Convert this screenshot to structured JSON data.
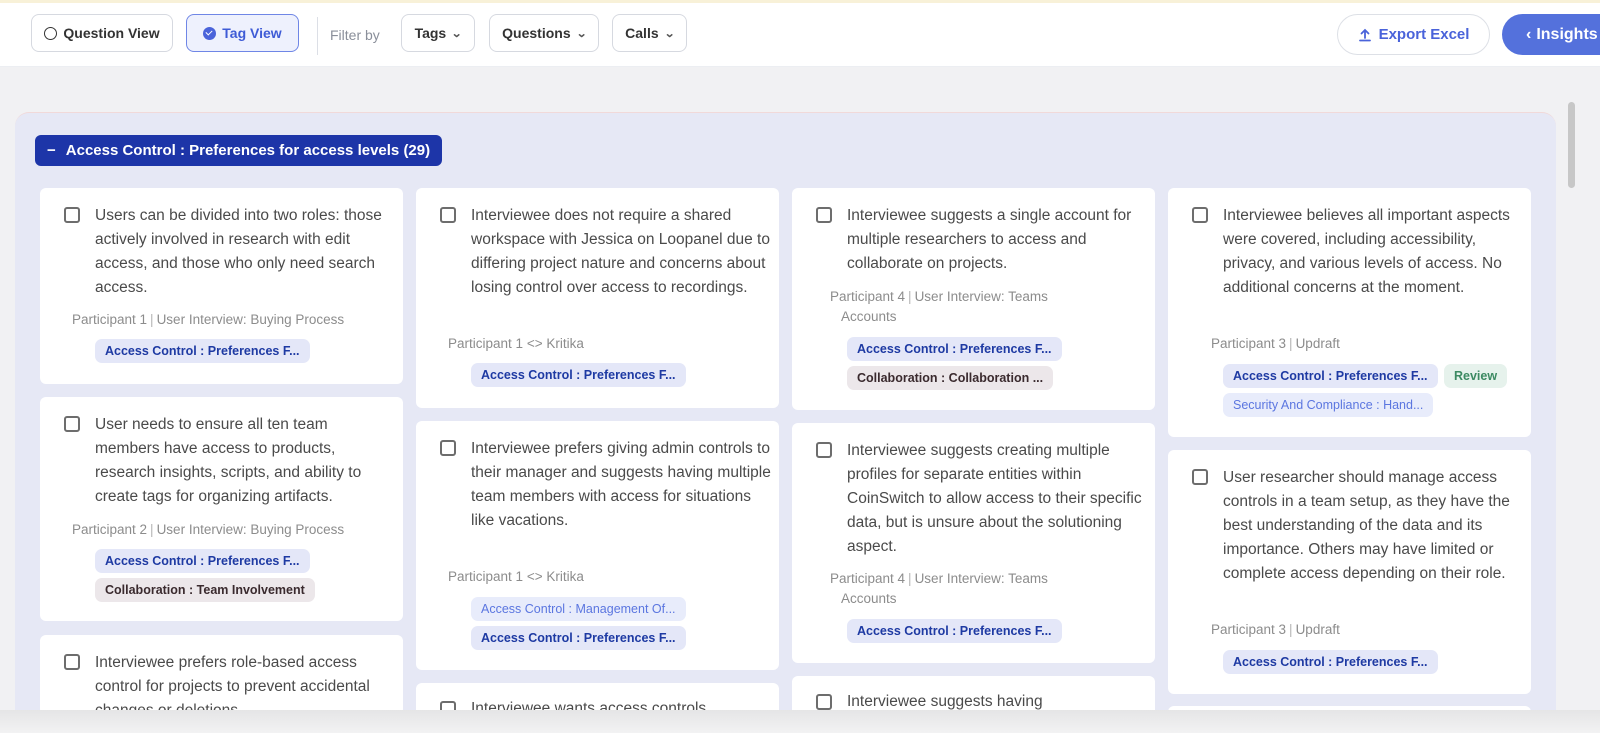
{
  "toolbar": {
    "question_view": "Question View",
    "tag_view": "Tag View",
    "filter_by": "Filter by",
    "tags": "Tags",
    "questions": "Questions",
    "calls": "Calls",
    "export_excel": "Export Excel",
    "insights": "Insights"
  },
  "group": {
    "title": "Access Control : Preferences for access levels (29)",
    "collapse_symbol": "−"
  },
  "cards": [
    {
      "text": "Users can be divided into two roles: those actively involved in research with edit access, and those who only need search access.",
      "participant": "Participant 1",
      "source": "User Interview: Buying Process",
      "tags": [
        "Access Control : Preferences F..."
      ]
    },
    {
      "text": "User needs to ensure all ten team members have access to products, research insights, scripts, and ability to create tags for organizing artifacts.",
      "participant": "Participant 2",
      "source": "User Interview: Buying Process",
      "tags": [
        "Access Control : Preferences F...",
        "Collaboration : Team Involvement"
      ]
    },
    {
      "text": "Interviewee prefers role-based access control for projects to prevent accidental changes or deletions."
    },
    {
      "text": "Interviewee does not require a shared workspace with Jessica on Loopanel due to differing project nature and concerns about losing control over access to recordings.",
      "participant": "Participant 1",
      "source": "<> Kritika",
      "tags": [
        "Access Control : Preferences F..."
      ]
    },
    {
      "text": "Interviewee prefers giving admin controls to their manager and suggests having multiple team members with access for situations like vacations.",
      "participant": "Participant 1",
      "source": "<> Kritika",
      "tags": [
        "Access Control : Management Of...",
        "Access Control : Preferences F..."
      ]
    },
    {
      "text": "Interviewee wants access controls"
    },
    {
      "text": "Interviewee suggests a single account for multiple researchers to access and collaborate on projects.",
      "participant": "Participant 4",
      "source": "User Interview: Teams",
      "source2": "Accounts",
      "tags": [
        "Access Control : Preferences F...",
        "Collaboration : Collaboration ..."
      ]
    },
    {
      "text": "Interviewee suggests creating multiple profiles for separate entities within CoinSwitch to allow access to their specific data, but is unsure about the solutioning aspect.",
      "participant": "Participant 4",
      "source": "User Interview: Teams",
      "source2": "Accounts",
      "tags": [
        "Access Control : Preferences F..."
      ]
    },
    {
      "text": "Interviewee suggests having"
    },
    {
      "text": "Interviewee believes all important aspects were covered, including accessibility, privacy, and various levels of access. No additional concerns at the moment.",
      "participant": "Participant 3",
      "source": "Updraft",
      "tags": [
        "Access Control : Preferences F...",
        "Review",
        "Security And Compliance : Hand..."
      ]
    },
    {
      "text": "User researcher should manage access controls in a team setup, as they have the best understanding of the data and its importance. Others may have limited or complete access depending on their role.",
      "participant": "Participant 3",
      "source": "Updraft",
      "tags": [
        "Access Control : Preferences F..."
      ]
    }
  ]
}
